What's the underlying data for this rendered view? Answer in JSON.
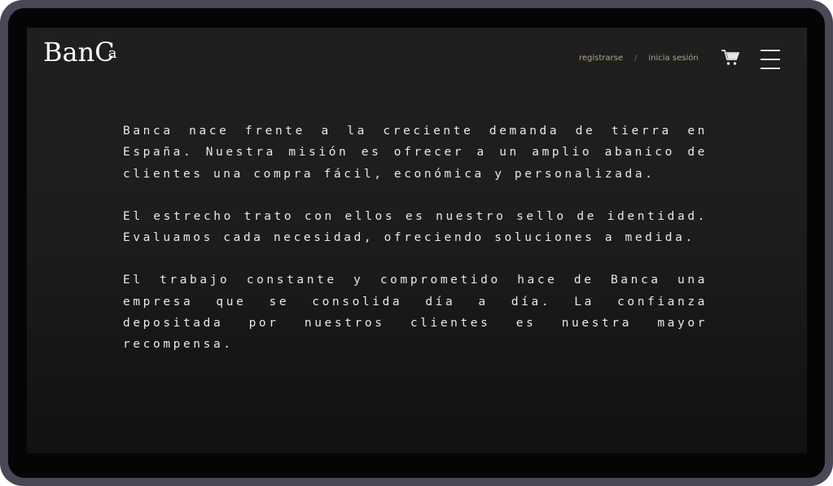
{
  "header": {
    "logo_main": "BanC",
    "logo_sup": "a",
    "register_label": "registrarse",
    "separator": "/",
    "login_label": "inicia sesión",
    "cart_icon": "cart-icon",
    "menu_icon": "hamburger-menu-icon"
  },
  "main": {
    "paragraphs": [
      "Banca nace frente a la creciente demanda de tierra en España. Nuestra misión es ofrecer a un amplio abanico de clientes una compra fácil, económica y personalizada.",
      "El estrecho trato con ellos es nuestro sello de identidad. Evaluamos cada necesidad, ofreciendo soluciones a medida.",
      "El trabajo constante y comprometido hace de Banca una empresa que se consolida día a día. La confianza depositada por nuestros clientes es nuestra mayor recompensa."
    ]
  },
  "colors": {
    "device_frame": "#4b4756",
    "screen_bg": "#1f1f1f",
    "accent_gold": "#b5a37e",
    "text": "#e8e8e8"
  }
}
